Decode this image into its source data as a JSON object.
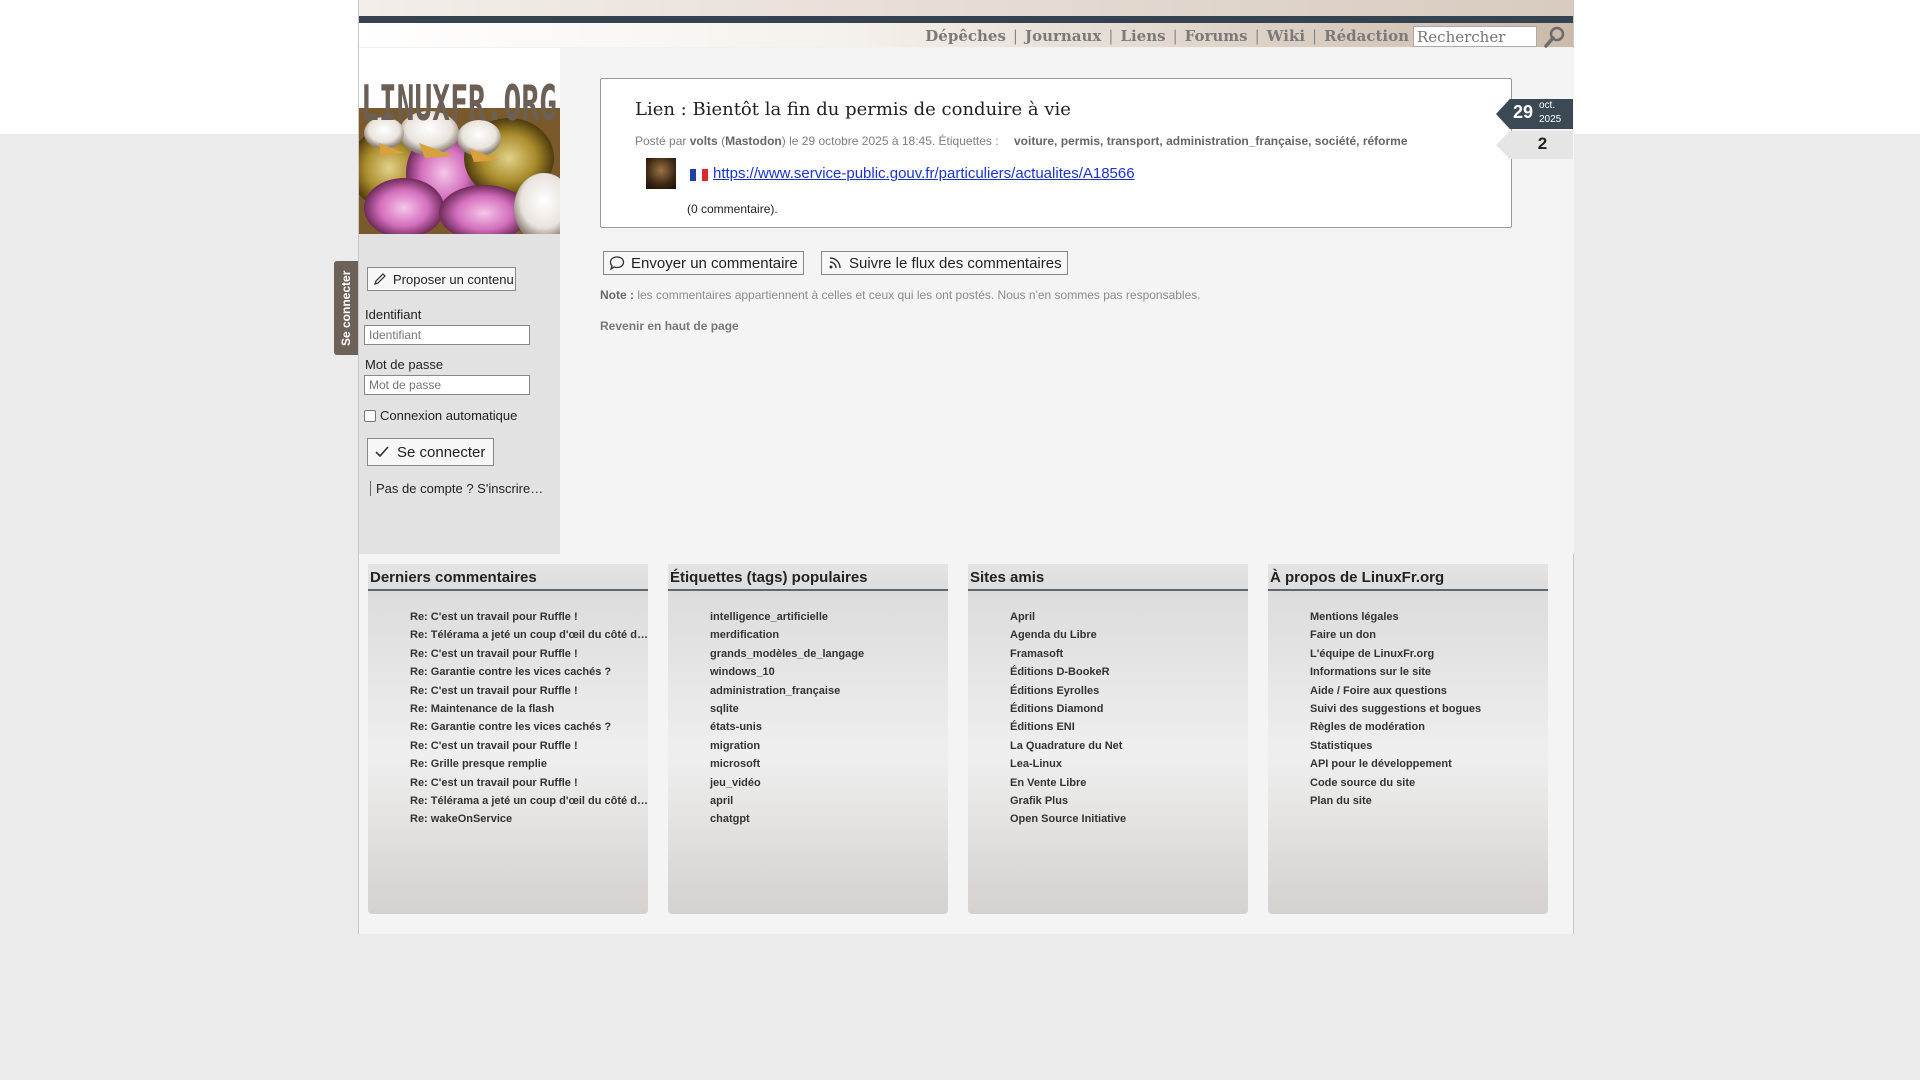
{
  "header": {
    "nav": [
      "Dépêches",
      "Journaux",
      "Liens",
      "Forums",
      "Wiki",
      "Rédaction"
    ],
    "search_placeholder": "Rechercher",
    "logo_text": "LINUXFR.ORG"
  },
  "sidebar": {
    "tab_label": "Se connecter",
    "propose_label": "Proposer un contenu",
    "login_label": "Identifiant",
    "login_placeholder": "Identifiant",
    "password_label": "Mot de passe",
    "password_placeholder": "Mot de passe",
    "remember_label": "Connexion automatique",
    "submit_label": "Se connecter",
    "signup_label": "Pas de compte ? S'inscrire…"
  },
  "article": {
    "title": "Lien : Bientôt la fin du permis de conduire à vie",
    "posted_by": "Posté par",
    "author": "volts",
    "author_network": "Mastodon",
    "date_text": "le 29 octobre 2025 à 18:45. Étiquettes :",
    "tags": [
      "voiture",
      "permis",
      "transport",
      "administration_française",
      "société",
      "réforme"
    ],
    "url": "https://www.service-public.gouv.fr/particuliers/actualites/A18566",
    "comments_count_text": "(0 commentaire).",
    "date_day": "29",
    "date_month": "oct.",
    "date_year": "2025",
    "score": "2",
    "flag_colors": [
      "#1f3ea8",
      "#ffffff",
      "#d92b2b"
    ]
  },
  "actions": {
    "send_comment": "Envoyer un commentaire",
    "follow_feed": "Suivre le flux des commentaires",
    "note_label": "Note :",
    "note_text": "les commentaires appartiennent à celles et ceux qui les ont postés. Nous n'en sommes pas responsables.",
    "back_to_top": "Revenir en haut de page"
  },
  "footer": {
    "columns": [
      {
        "title": "Derniers commentaires",
        "items": [
          "Re: C'est un travail pour Ruffle !",
          "Re: Télérama a jeté un coup d'œil du côté de Linux",
          "Re: C'est un travail pour Ruffle !",
          "Re: Garantie contre les vices cachés ?",
          "Re: C'est un travail pour Ruffle !",
          "Re: Maintenance de la flash",
          "Re: Garantie contre les vices cachés ?",
          "Re: C'est un travail pour Ruffle !",
          "Re: Grille presque remplie",
          "Re: C'est un travail pour Ruffle !",
          "Re: Télérama a jeté un coup d'œil du côté de Linux",
          "Re: wakeOnService"
        ]
      },
      {
        "title": "Étiquettes (tags) populaires",
        "items": [
          "intelligence_artificielle",
          "merdification",
          "grands_modèles_de_langage",
          "windows_10",
          "administration_française",
          "sqlite",
          "états-unis",
          "migration",
          "microsoft",
          "jeu_vidéo",
          "april",
          "chatgpt"
        ]
      },
      {
        "title": "Sites amis",
        "items": [
          "April",
          "Agenda du Libre",
          "Framasoft",
          "Éditions D-BookeR",
          "Éditions Eyrolles",
          "Éditions Diamond",
          "Éditions ENI",
          "La Quadrature du Net",
          "Lea-Linux",
          "En Vente Libre",
          "Grafik Plus",
          "Open Source Initiative"
        ]
      },
      {
        "title": "À propos de LinuxFr.org",
        "items": [
          "Mentions légales",
          "Faire un don",
          "L'équipe de LinuxFr.org",
          "Informations sur le site",
          "Aide / Foire aux questions",
          "Suivi des suggestions et bogues",
          "Règles de modération",
          "Statistiques",
          "API pour le développement",
          "Code source du site",
          "Plan du site"
        ]
      }
    ]
  }
}
